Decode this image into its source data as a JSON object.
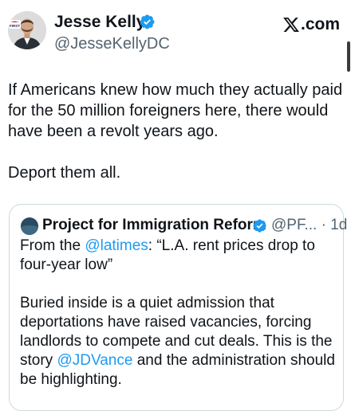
{
  "author": {
    "name": "Jesse Kelly",
    "handle": "@JesseKellyDC",
    "avatar_badge": "FIRST"
  },
  "brand": {
    "logo_icon": "x-logo-icon",
    "domain_suffix": ".com"
  },
  "tweet": {
    "paragraph_1": "If Americans knew how much they actually paid for the 50 million foreigners here, there would have been a revolt years ago.",
    "paragraph_2": "Deport them all."
  },
  "quoted": {
    "name": "Project for Immigration Reform",
    "handle_time": "@PF... · 1d",
    "line1_prefix": "From the ",
    "line1_mention": "@latimes",
    "line1_suffix": ": “L.A. rent prices drop to four-year low”",
    "para2_prefix": "Buried inside is a quiet admission that deportations have raised vacancies, forcing landlords to compete and cut deals. This is the story ",
    "para2_mention": "@JDVance",
    "para2_suffix": " and the administration should be highlighting."
  },
  "colors": {
    "text": "#0f1419",
    "secondary": "#536471",
    "link": "#1d9bf0",
    "verified": "#1d9bf0",
    "border": "#cfd9de"
  }
}
